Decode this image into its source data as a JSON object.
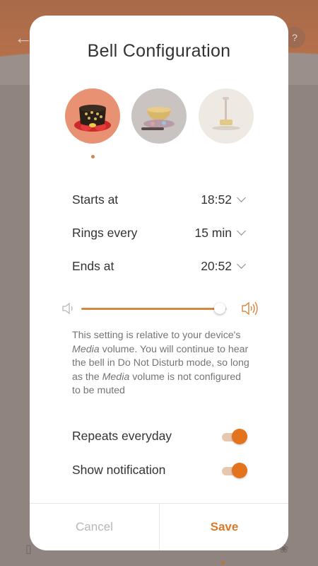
{
  "dialog": {
    "title": "Bell Configuration",
    "bells": [
      {
        "name": "bell-1",
        "selected": true
      },
      {
        "name": "bell-2",
        "selected": false
      },
      {
        "name": "bell-3",
        "selected": false
      }
    ],
    "schedule": {
      "starts_label": "Starts at",
      "starts_value": "18:52",
      "rings_label": "Rings every",
      "rings_value": "15 min",
      "ends_label": "Ends at",
      "ends_value": "20:52"
    },
    "volume": {
      "level": 0.95,
      "low_icon": "speaker-low-icon",
      "high_icon": "speaker-high-icon"
    },
    "note": {
      "p1": "This setting is relative to your device's ",
      "m1": "Media",
      "p2": " volume. You will continue to hear the bell in Do Not Disturb mode, so long as the ",
      "m2": "Media",
      "p3": " volume is not configured to be muted"
    },
    "toggles": {
      "repeats_label": "Repeats everyday",
      "repeats_on": true,
      "notification_label": "Show notification",
      "notification_on": true
    },
    "buttons": {
      "cancel": "Cancel",
      "save": "Save"
    }
  },
  "colors": {
    "accent": "#d97a2a",
    "toggle_on": "#e3731c",
    "slider_fill": "#d3873f"
  }
}
